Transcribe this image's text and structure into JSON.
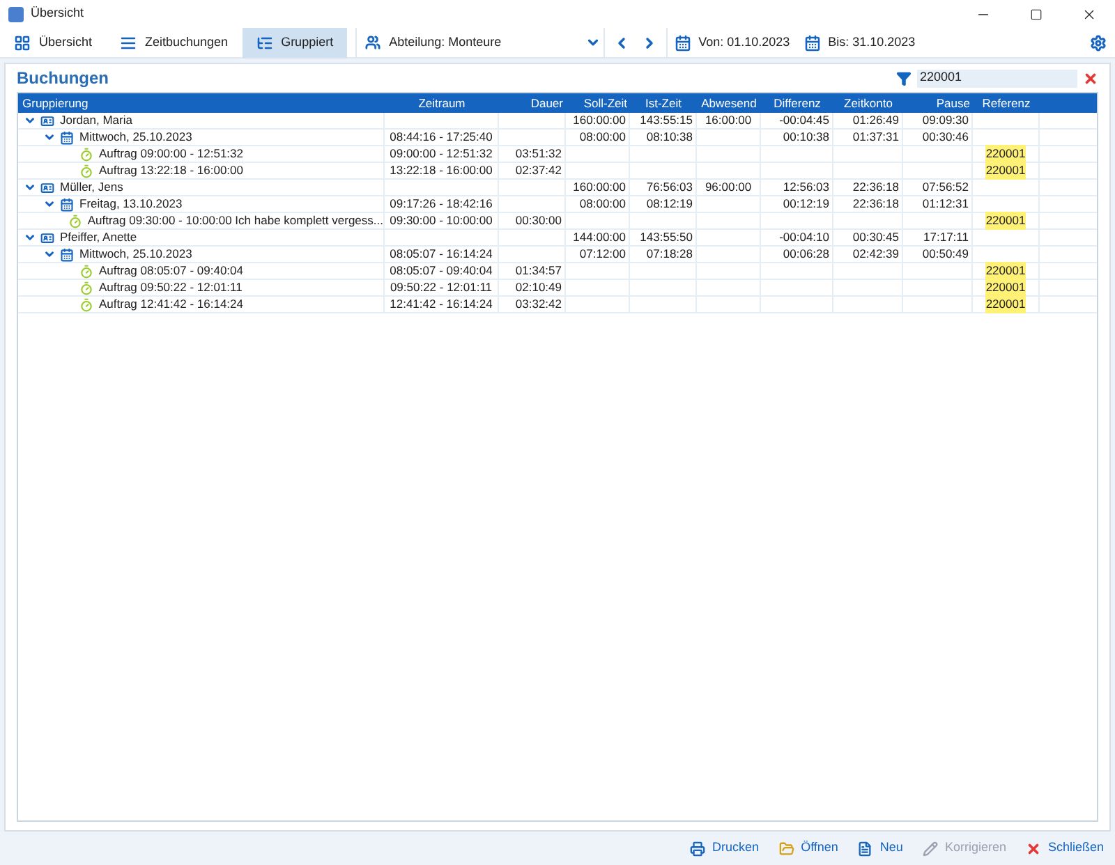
{
  "window": {
    "title": "Übersicht"
  },
  "tabs": [
    {
      "label": "Übersicht",
      "kind": "grid",
      "selected": false
    },
    {
      "label": "Zeitbuchungen",
      "kind": "list",
      "selected": false
    },
    {
      "label": "Gruppiert",
      "kind": "tree",
      "selected": true
    }
  ],
  "department": {
    "value": "Abteilung: Monteure"
  },
  "date_from": "Von: 01.10.2023",
  "date_to": "Bis: 31.10.2023",
  "panel": {
    "title": "Buchungen",
    "filter": {
      "value": "220001"
    }
  },
  "table": {
    "tree_column": "Gruppierung",
    "columns": [
      "Zeitraum",
      "Dauer",
      "Soll-Zeit",
      "Ist-Zeit",
      "Abwesend",
      "Differenz",
      "Zeitkonto",
      "Pause",
      "Referenz"
    ],
    "rows": [
      {
        "kind": "person",
        "label": "Jordan, Maria",
        "expanded": true,
        "cells": [
          "",
          "",
          "160:00:00",
          "143:55:15",
          "16:00:00",
          "-00:04:45",
          "01:26:49",
          "09:09:30",
          ""
        ],
        "children": [
          {
            "kind": "day",
            "label": "Mittwoch, 25.10.2023",
            "expanded": true,
            "cells": [
              "08:44:16 - 17:25:40",
              "",
              "08:00:00",
              "08:10:38",
              "",
              "00:10:38",
              "01:37:31",
              "00:30:46",
              ""
            ],
            "children": [
              {
                "kind": "order",
                "label": "Auftrag 09:00:00 - 12:51:32",
                "cells": [
                  "09:00:00 - 12:51:32",
                  "03:51:32",
                  "",
                  "",
                  "",
                  "",
                  "",
                  "",
                  "220001"
                ],
                "match": true
              },
              {
                "kind": "order",
                "label": "Auftrag 13:22:18 - 16:00:00",
                "cells": [
                  "13:22:18 - 16:00:00",
                  "02:37:42",
                  "",
                  "",
                  "",
                  "",
                  "",
                  "",
                  "220001"
                ],
                "match": true
              }
            ]
          }
        ]
      },
      {
        "kind": "person",
        "label": "Müller, Jens",
        "expanded": true,
        "cells": [
          "",
          "",
          "160:00:00",
          "76:56:03",
          "96:00:00",
          "12:56:03",
          "22:36:18",
          "07:56:52",
          ""
        ],
        "children": [
          {
            "kind": "day",
            "label": "Freitag, 13.10.2023",
            "expanded": true,
            "cells": [
              "09:17:26 - 18:42:16",
              "",
              "08:00:00",
              "08:12:19",
              "",
              "00:12:19",
              "22:36:18",
              "01:12:31",
              ""
            ],
            "children": [
              {
                "kind": "order",
                "label": "Auftrag 09:30:00 - 10:00:00 Ich habe komplett vergess...",
                "cells": [
                  "09:30:00 - 10:00:00",
                  "00:30:00",
                  "",
                  "",
                  "",
                  "",
                  "",
                  "",
                  "220001"
                ],
                "match": true
              }
            ]
          }
        ]
      },
      {
        "kind": "person",
        "label": "Pfeiffer, Anette",
        "expanded": true,
        "cells": [
          "",
          "",
          "144:00:00",
          "143:55:50",
          "",
          "-00:04:10",
          "00:30:45",
          "17:17:11",
          ""
        ],
        "children": [
          {
            "kind": "day",
            "label": "Mittwoch, 25.10.2023",
            "expanded": true,
            "cells": [
              "08:05:07 - 16:14:24",
              "",
              "07:12:00",
              "07:18:28",
              "",
              "00:06:28",
              "02:42:39",
              "00:50:49",
              ""
            ],
            "children": [
              {
                "kind": "order",
                "label": "Auftrag 08:05:07 - 09:40:04",
                "cells": [
                  "08:05:07 - 09:40:04",
                  "01:34:57",
                  "",
                  "",
                  "",
                  "",
                  "",
                  "",
                  "220001"
                ],
                "match": true
              },
              {
                "kind": "order",
                "label": "Auftrag 09:50:22 - 12:01:11",
                "cells": [
                  "09:50:22 - 12:01:11",
                  "02:10:49",
                  "",
                  "",
                  "",
                  "",
                  "",
                  "",
                  "220001"
                ],
                "match": true
              },
              {
                "kind": "order",
                "label": "Auftrag 12:41:42 - 16:14:24",
                "cells": [
                  "12:41:42 - 16:14:24",
                  "03:32:42",
                  "",
                  "",
                  "",
                  "",
                  "",
                  "",
                  "220001"
                ],
                "match": true
              }
            ]
          }
        ]
      }
    ]
  },
  "footer_buttons": [
    {
      "label": "Drucken",
      "kind": "print",
      "disabled": false
    },
    {
      "label": "Öffnen",
      "kind": "open",
      "disabled": false
    },
    {
      "label": "Neu",
      "kind": "new",
      "disabled": false
    },
    {
      "label": "Korrigieren",
      "kind": "edit",
      "disabled": true
    },
    {
      "label": "Schließen",
      "kind": "close",
      "disabled": false
    }
  ]
}
